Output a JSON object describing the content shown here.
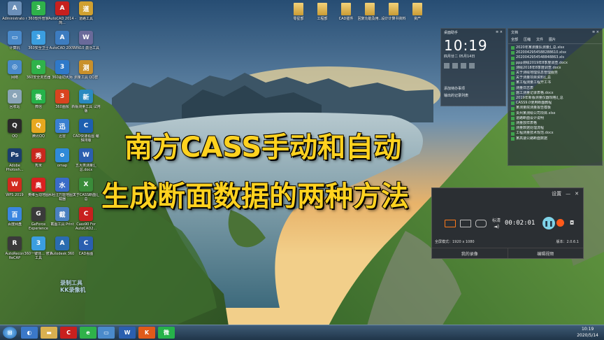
{
  "title_lines": [
    "南方CASS手动和自动",
    "生成断面数据的两种方法"
  ],
  "watermark": [
    "录制工具",
    "KK录像机"
  ],
  "desktop_icons": [
    {
      "label": "Administrato r",
      "color": "#6b8fb8",
      "glyph": "A"
    },
    {
      "label": "360软件管家",
      "color": "#2fb24a",
      "glyph": "3"
    },
    {
      "label": "AutoCAD 2014 - 简...",
      "color": "#c8201e",
      "glyph": "A"
    },
    {
      "label": "道路工具",
      "color": "#d0a030",
      "glyph": "道"
    },
    {
      "label": "计算机",
      "color": "#4a8acb",
      "glyph": "▭"
    },
    {
      "label": "360安全卫士",
      "color": "#3b9ee0",
      "glyph": "3"
    },
    {
      "label": "AutoCAD 2007",
      "color": "#3d7cc0",
      "glyph": "A"
    },
    {
      "label": "WIN10 激活工具",
      "color": "#6a6a9a",
      "glyph": "W"
    },
    {
      "label": "网络",
      "color": "#4a8acb",
      "glyph": "◎"
    },
    {
      "label": "360安全浏览器",
      "color": "#2fb24a",
      "glyph": "e"
    },
    {
      "label": "360驱动大师",
      "color": "#2f79c9",
      "glyph": "3"
    },
    {
      "label": "测量工具 QQ群",
      "color": "#c9902b",
      "glyph": "测"
    },
    {
      "label": "回收站",
      "color": "#8aa5b8",
      "glyph": "♻"
    },
    {
      "label": "微信",
      "color": "#26b24a",
      "glyph": "微"
    },
    {
      "label": "360画报",
      "color": "#d9441f",
      "glyph": "3"
    },
    {
      "label": "新版测量工具 试用版",
      "color": "#2a8ac0",
      "glyph": "新"
    },
    {
      "label": "QQ",
      "color": "#2a2a2a",
      "glyph": "Q"
    },
    {
      "label": "腾讯QQ",
      "color": "#e7a81f",
      "glyph": "Q"
    },
    {
      "label": "迅雷",
      "color": "#3a7fd0",
      "glyph": "迅"
    },
    {
      "label": "CAD快速看图 编辑排版",
      "color": "#1d5fb0",
      "glyph": "C"
    },
    {
      "label": "Adobe Photosh...",
      "color": "#1c3e6e",
      "glyph": "Ps"
    },
    {
      "label": "秀米",
      "color": "#c8281e",
      "glyph": "秀"
    },
    {
      "label": "omap",
      "color": "#2f8ad8",
      "glyph": "o"
    },
    {
      "label": "五大类测量汇总.docx",
      "color": "#2b5faf",
      "glyph": "W"
    },
    {
      "label": "WPS 2019",
      "color": "#d22a1e",
      "glyph": "W"
    },
    {
      "label": "奥维互动地图",
      "color": "#d82020",
      "glyph": "奥"
    },
    {
      "label": "水经注万能地图下载器",
      "color": "#3a6cc8",
      "glyph": "水"
    },
    {
      "label": "关于CASS断面汇总",
      "color": "#3a8c3a",
      "glyph": "X"
    },
    {
      "label": "百度网盘",
      "color": "#3a86e0",
      "glyph": "百"
    },
    {
      "label": "GeForce Experience",
      "color": "#3a3a3a",
      "glyph": "G"
    },
    {
      "label": "截图工具 Print",
      "color": "#4a80c0",
      "glyph": "截"
    },
    {
      "label": "Cass90 For AutoCAD2...",
      "color": "#c8201e",
      "glyph": "C"
    },
    {
      "label": "AutoRecon ReCAP",
      "color": "#3a3a3a",
      "glyph": "R"
    },
    {
      "label": "360一键体... 修复工具",
      "color": "#3b9ee0",
      "glyph": "3"
    },
    {
      "label": "Autodesk 360",
      "color": "#2a6cb0",
      "glyph": "A"
    },
    {
      "label": "CAD看图",
      "color": "#2a5fb0",
      "glyph": "C"
    }
  ],
  "folders": [
    "零星部",
    "工程部",
    "CAD插件",
    "回复功能及用...",
    "设计计算书资料",
    "资产"
  ],
  "clock_widget": {
    "title": "桌面助手",
    "time": "10:19",
    "date": "四月廿二    05月14日",
    "rows": [
      "添加待办事项",
      "输出的记录列表"
    ]
  },
  "docs_widget": {
    "title": "文档",
    "tabs": [
      "全部",
      "压缩",
      "文件",
      "图片"
    ],
    "items": [
      "2020年某测量队测量汇总.xlsx",
      "2020042954588288610.xlsx",
      "2020042954548848863.xls",
      "ppp测绘2019年8季度调查.docx",
      "测绘2018年8季度调查.docx",
      "关于测绘地理信息管理服务",
      "关于测量项目资料汇总",
      "某工程测量工程开工书",
      "测量日志表",
      "施工测量记录表格.docx",
      "2019年新版测量仪器规格汇总",
      "CASS9.0使用断面教程",
      "某测量院测量报告模板",
      "贵州某测绘公司项目.xlsx",
      "道路断面设计说明",
      "测量放样表格",
      "测量数据处理流程",
      "工程测量技术规范.docx",
      "某高速公路断面数据"
    ]
  },
  "recorder": {
    "header_label": "设置",
    "quality_label": "标清",
    "timer": "00:02:01",
    "mode_label": "全屏模式：1920 x 1080",
    "version": "版本：2.0.6.1",
    "footer": [
      "我的录像",
      "编辑视频"
    ]
  },
  "taskbar": {
    "time": "10:19",
    "date": "2020/5/14"
  }
}
